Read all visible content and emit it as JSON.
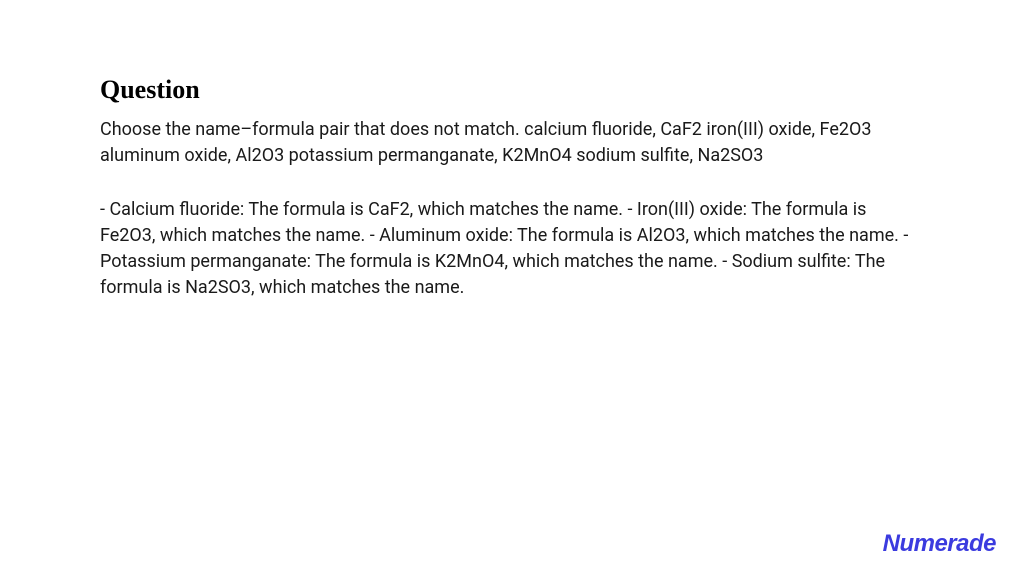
{
  "content": {
    "heading": "Question",
    "question_text": "Choose the name–formula pair that does not match. calcium fluoride, CaF2 iron(III) oxide, Fe2O3 aluminum oxide, Al2O3 potassium permanganate, K2MnO4 sodium sulfite, Na2SO3",
    "answer_text": "- Calcium fluoride: The formula is CaF2, which matches the name. - Iron(III) oxide: The formula is Fe2O3, which matches the name. - Aluminum oxide: The formula is Al2O3, which matches the name. - Potassium permanganate: The formula is K2MnO4, which matches the name. - Sodium sulfite: The formula is Na2SO3, which matches the name."
  },
  "brand": {
    "name": "Numerade"
  }
}
